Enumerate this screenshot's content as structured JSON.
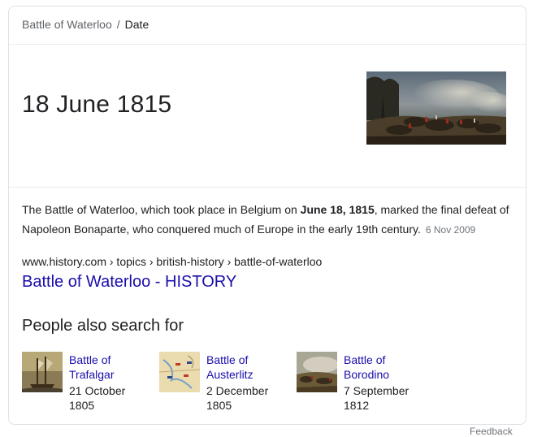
{
  "breadcrumb": {
    "topic": "Battle of Waterloo",
    "separator": "/",
    "attribute": "Date"
  },
  "answer": "18 June 1815",
  "main_image": {
    "label": "Painting of the Battle of Waterloo"
  },
  "snippet": {
    "before": "The Battle of Waterloo, which took place in Belgium on ",
    "bold": "June 18, 1815",
    "after": ", marked the final defeat of Napoleon Bonaparte, who conquered much of Europe in the early 19th century.",
    "date": "6 Nov 2009"
  },
  "source": {
    "cite": "www.history.com › topics › british-history › battle-of-waterloo",
    "title": "Battle of Waterloo - HISTORY"
  },
  "people_also_search": {
    "heading": "People also search for",
    "items": [
      {
        "name_line1": "Battle of",
        "name_line2": "Trafalgar",
        "date_line1": "21 October",
        "date_line2": "1805"
      },
      {
        "name_line1": "Battle of",
        "name_line2": "Austerlitz",
        "date_line1": "2 December",
        "date_line2": "1805"
      },
      {
        "name_line1": "Battle of",
        "name_line2": "Borodino",
        "date_line1": "7 September",
        "date_line2": "1812"
      }
    ]
  },
  "footer": {
    "feedback": "Feedback"
  },
  "colors": {
    "link": "#1a0dab",
    "text": "#202124",
    "muted": "#70757a",
    "border": "#dfe1e5"
  }
}
